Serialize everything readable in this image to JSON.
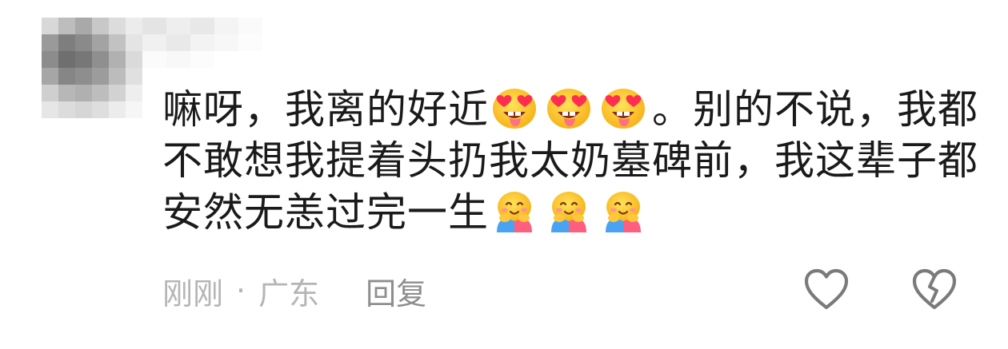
{
  "comment": {
    "lines": [
      {
        "segments": [
          {
            "text": "嘛呀，我离的好近"
          },
          {
            "emoji": "heart-eyes-tongue-icon"
          },
          {
            "emoji": "heart-eyes-tongue-icon"
          },
          {
            "emoji": "heart-eyes-tongue-icon"
          },
          {
            "text": "。别的不说，我都"
          }
        ]
      },
      {
        "segments": [
          {
            "text": "不敢想我提着头扔我太奶墓碑前，我这辈子都"
          }
        ]
      },
      {
        "segments": [
          {
            "text": "安然无恙过完一生"
          },
          {
            "emoji": "hugging-face-icon"
          },
          {
            "emoji": "hugging-face-icon"
          },
          {
            "emoji": "hugging-face-icon"
          }
        ]
      }
    ],
    "time": "刚刚",
    "separator": "·",
    "location": "广东",
    "reply_label": "回复"
  },
  "colors": {
    "text": "#1a1a1a",
    "meta": "#b5b5b5",
    "reply": "#8e8e8e",
    "icon": "#7a7a7a"
  }
}
